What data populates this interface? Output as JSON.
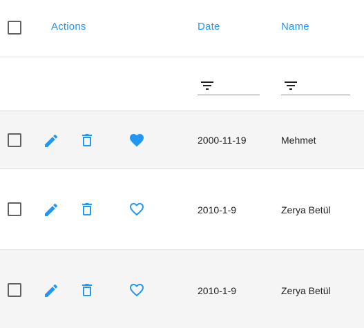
{
  "colors": {
    "accent": "#2196f3",
    "row_shade": "#f5f5f5",
    "divider": "#e0e0e0"
  },
  "header": {
    "actions_label": "Actions",
    "date_label": "Date",
    "name_label": "Name"
  },
  "filters": {
    "date": {
      "icon": "filter-icon",
      "value": ""
    },
    "name": {
      "icon": "filter-icon",
      "value": ""
    }
  },
  "rows": [
    {
      "date": "2000-11-19",
      "name": "Mehmet",
      "favorite": true
    },
    {
      "date": "2010-1-9",
      "name": "Zerya Betül",
      "favorite": false
    },
    {
      "date": "2010-1-9",
      "name": "Zerya Betül",
      "favorite": false
    }
  ]
}
